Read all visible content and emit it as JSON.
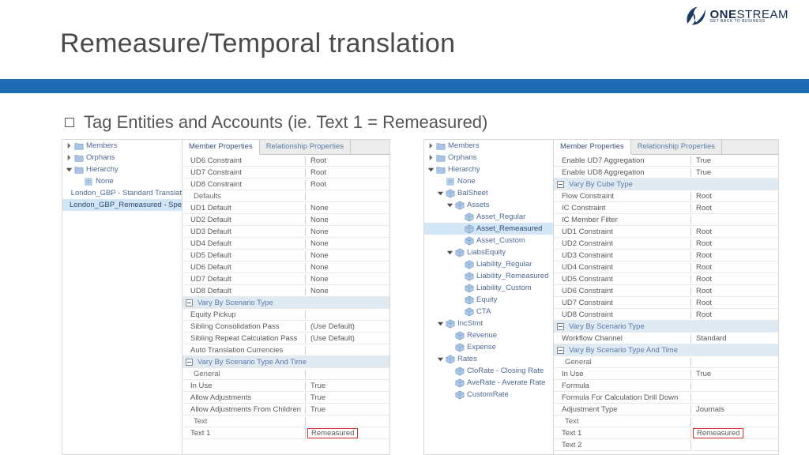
{
  "title": "Remeasure/Temporal translation",
  "subtitle": "Tag Entities and Accounts (ie. Text 1 = Remeasured)",
  "logo": {
    "brand_a": "ONE",
    "brand_b": "STREAM",
    "tag": "GET BACK TO BUSINESS"
  },
  "tabs": {
    "member": "Member Properties",
    "relationship": "Relationship Properties"
  },
  "left_tree": [
    {
      "lvl": 0,
      "exp": "r",
      "ico": "folder",
      "lbl": "Members"
    },
    {
      "lvl": 0,
      "exp": "r",
      "ico": "folder",
      "lbl": "Orphans"
    },
    {
      "lvl": 0,
      "exp": "d",
      "ico": "folder",
      "lbl": "Hierarchy"
    },
    {
      "lvl": 1,
      "exp": "",
      "ico": "item",
      "lbl": "None"
    },
    {
      "lvl": 1,
      "exp": "",
      "ico": "item",
      "lbl": "London_GBP - Standard Translat"
    },
    {
      "lvl": 1,
      "exp": "",
      "ico": "item",
      "lbl": "London_GBP_Remeasured - Spe",
      "sel": true
    }
  ],
  "right_tree": [
    {
      "lvl": 0,
      "exp": "r",
      "ico": "folder",
      "lbl": "Members"
    },
    {
      "lvl": 0,
      "exp": "r",
      "ico": "folder",
      "lbl": "Orphans"
    },
    {
      "lvl": 0,
      "exp": "d",
      "ico": "folder",
      "lbl": "Hierarchy"
    },
    {
      "lvl": 1,
      "exp": "",
      "ico": "item",
      "lbl": "None"
    },
    {
      "lvl": 1,
      "exp": "d",
      "ico": "cube",
      "lbl": "BalSheet"
    },
    {
      "lvl": 2,
      "exp": "d",
      "ico": "cube",
      "lbl": "Assets"
    },
    {
      "lvl": 3,
      "exp": "",
      "ico": "cube",
      "lbl": "Asset_Regular"
    },
    {
      "lvl": 3,
      "exp": "",
      "ico": "cube",
      "lbl": "Asset_Remeasured",
      "sel": true
    },
    {
      "lvl": 3,
      "exp": "",
      "ico": "cube",
      "lbl": "Asset_Custom"
    },
    {
      "lvl": 2,
      "exp": "d",
      "ico": "cube",
      "lbl": "LiabsEquity"
    },
    {
      "lvl": 3,
      "exp": "",
      "ico": "cube",
      "lbl": "Liability_Regular"
    },
    {
      "lvl": 3,
      "exp": "",
      "ico": "cube",
      "lbl": "Liability_Remeasured"
    },
    {
      "lvl": 3,
      "exp": "",
      "ico": "cube",
      "lbl": "Liability_Custom"
    },
    {
      "lvl": 3,
      "exp": "",
      "ico": "cube",
      "lbl": "Equity"
    },
    {
      "lvl": 3,
      "exp": "",
      "ico": "cube",
      "lbl": "CTA"
    },
    {
      "lvl": 1,
      "exp": "d",
      "ico": "cube",
      "lbl": "IncStmt"
    },
    {
      "lvl": 2,
      "exp": "",
      "ico": "cube",
      "lbl": "Revenue"
    },
    {
      "lvl": 2,
      "exp": "",
      "ico": "cube",
      "lbl": "Expense"
    },
    {
      "lvl": 1,
      "exp": "d",
      "ico": "cube",
      "lbl": "Rates"
    },
    {
      "lvl": 2,
      "exp": "",
      "ico": "cube",
      "lbl": "CloRate - Closing Rate"
    },
    {
      "lvl": 2,
      "exp": "",
      "ico": "cube",
      "lbl": "AveRate - Averate Rate"
    },
    {
      "lvl": 2,
      "exp": "",
      "ico": "cube",
      "lbl": "CustomRate"
    }
  ],
  "left_props": [
    {
      "t": "row",
      "k": "UD6 Constraint",
      "v": "Root"
    },
    {
      "t": "row",
      "k": "UD7 Constraint",
      "v": "Root"
    },
    {
      "t": "row",
      "k": "UD8 Constraint",
      "v": "Root"
    },
    {
      "t": "sub",
      "k": "Defaults"
    },
    {
      "t": "row",
      "k": "UD1 Default",
      "v": "None"
    },
    {
      "t": "row",
      "k": "UD2 Default",
      "v": "None"
    },
    {
      "t": "row",
      "k": "UD3 Default",
      "v": "None"
    },
    {
      "t": "row",
      "k": "UD4 Default",
      "v": "None"
    },
    {
      "t": "row",
      "k": "UD5 Default",
      "v": "None"
    },
    {
      "t": "row",
      "k": "UD6 Default",
      "v": "None"
    },
    {
      "t": "row",
      "k": "UD7 Default",
      "v": "None"
    },
    {
      "t": "row",
      "k": "UD8 Default",
      "v": "None"
    },
    {
      "t": "hdr",
      "k": "Vary By Scenario Type"
    },
    {
      "t": "row",
      "k": "Equity Pickup",
      "v": ""
    },
    {
      "t": "row",
      "k": "Sibling Consolidation Pass",
      "v": "(Use Default)"
    },
    {
      "t": "row",
      "k": "Sibling Repeat Calculation Pass",
      "v": "(Use Default)"
    },
    {
      "t": "row",
      "k": "Auto Translation Currencies",
      "v": ""
    },
    {
      "t": "hdr",
      "k": "Vary By Scenario Type And Time"
    },
    {
      "t": "sub",
      "k": "General"
    },
    {
      "t": "row",
      "k": "In Use",
      "v": "True"
    },
    {
      "t": "row",
      "k": "Allow Adjustments",
      "v": "True"
    },
    {
      "t": "row",
      "k": "Allow Adjustments From Children",
      "v": "True"
    },
    {
      "t": "sub",
      "k": "Text"
    },
    {
      "t": "row",
      "k": "Text 1",
      "v": "Remeasured",
      "hl": true
    }
  ],
  "right_props": [
    {
      "t": "row",
      "k": "Enable UD7 Aggregation",
      "v": "True"
    },
    {
      "t": "row",
      "k": "Enable UD8 Aggregation",
      "v": "True"
    },
    {
      "t": "hdr",
      "k": "Vary By Cube Type"
    },
    {
      "t": "row",
      "k": "Flow Constraint",
      "v": "Root"
    },
    {
      "t": "row",
      "k": "IC Constraint",
      "v": "Root"
    },
    {
      "t": "row",
      "k": "IC Member Filter",
      "v": ""
    },
    {
      "t": "row",
      "k": "UD1 Constraint",
      "v": "Root"
    },
    {
      "t": "row",
      "k": "UD2 Constraint",
      "v": "Root"
    },
    {
      "t": "row",
      "k": "UD3 Constraint",
      "v": "Root"
    },
    {
      "t": "row",
      "k": "UD4 Constraint",
      "v": "Root"
    },
    {
      "t": "row",
      "k": "UD5 Constraint",
      "v": "Root"
    },
    {
      "t": "row",
      "k": "UD6 Constraint",
      "v": "Root"
    },
    {
      "t": "row",
      "k": "UD7 Constraint",
      "v": "Root"
    },
    {
      "t": "row",
      "k": "UD8 Constraint",
      "v": "Root"
    },
    {
      "t": "hdr",
      "k": "Vary By Scenario Type"
    },
    {
      "t": "row",
      "k": "Workflow Channel",
      "v": "Standard"
    },
    {
      "t": "hdr",
      "k": "Vary By Scenario Type And Time"
    },
    {
      "t": "sub",
      "k": "General"
    },
    {
      "t": "row",
      "k": "In Use",
      "v": "True"
    },
    {
      "t": "row",
      "k": "Formula",
      "v": ""
    },
    {
      "t": "row",
      "k": "Formula For Calculation Drill Down",
      "v": ""
    },
    {
      "t": "row",
      "k": "Adjustment Type",
      "v": "Journals"
    },
    {
      "t": "sub",
      "k": "Text"
    },
    {
      "t": "row",
      "k": "Text 1",
      "v": "Remeasured",
      "hl": true
    },
    {
      "t": "row",
      "k": "Text 2",
      "v": ""
    }
  ]
}
